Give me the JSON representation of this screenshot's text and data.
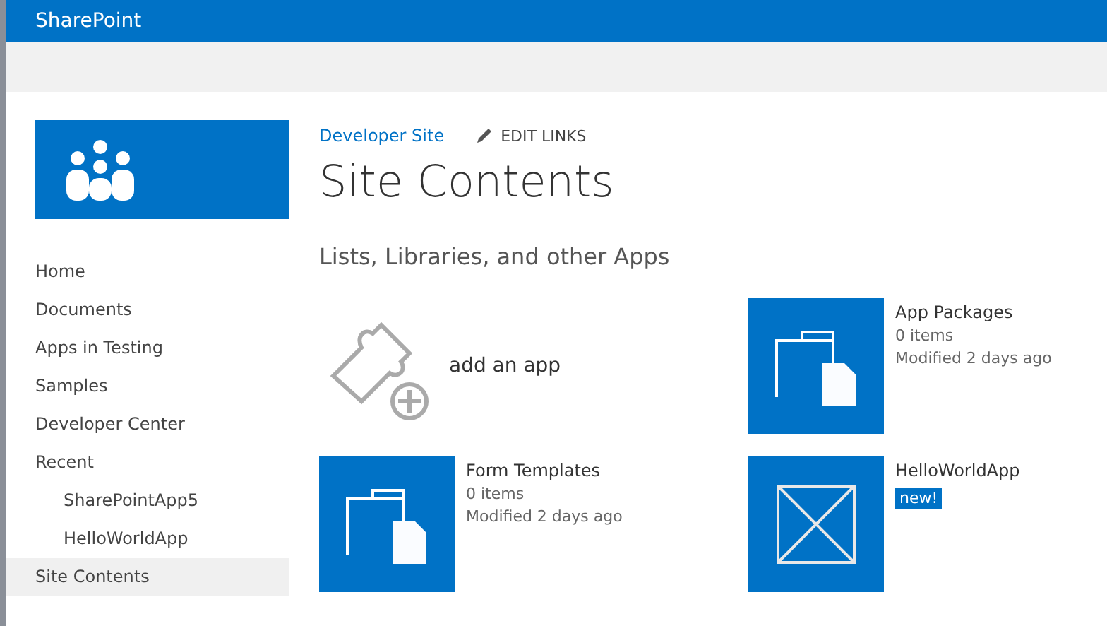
{
  "suite_bar": {
    "title": "SharePoint"
  },
  "breadcrumb": {
    "site_link": "Developer Site",
    "edit_links": "EDIT LINKS"
  },
  "page_title": "Site Contents",
  "nav": [
    {
      "label": "Home",
      "selected": false
    },
    {
      "label": "Documents",
      "selected": false
    },
    {
      "label": "Apps in Testing",
      "selected": false
    },
    {
      "label": "Samples",
      "selected": false
    },
    {
      "label": "Developer Center",
      "selected": false
    },
    {
      "label": "Recent",
      "selected": false,
      "children": [
        {
          "label": "SharePointApp5",
          "selected": false
        },
        {
          "label": "HelloWorldApp",
          "selected": false
        }
      ]
    },
    {
      "label": "Site Contents",
      "selected": true
    }
  ],
  "section_heading": "Lists, Libraries, and other Apps",
  "tiles": [
    {
      "kind": "add",
      "title": "add an app"
    },
    {
      "kind": "folder",
      "title": "App Packages",
      "count": "0 items",
      "modified": "Modified 2 days ago"
    },
    {
      "kind": "folder",
      "title": "Form Templates",
      "count": "0 items",
      "modified": "Modified 2 days ago"
    },
    {
      "kind": "app",
      "title": "HelloWorldApp",
      "badge": "new!"
    }
  ]
}
